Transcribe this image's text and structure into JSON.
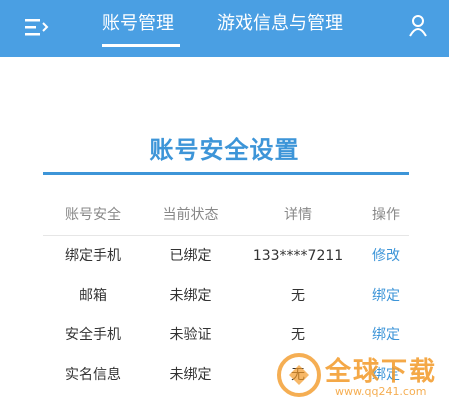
{
  "header": {
    "tabs": [
      {
        "label": "账号管理",
        "active": true
      },
      {
        "label": "游戏信息与管理",
        "active": false
      }
    ],
    "icons": {
      "menu": "menu-icon",
      "user": "user-icon"
    },
    "background_color": "#4a9fe3"
  },
  "main": {
    "title": "账号安全设置",
    "accent_color": "#3d95d8",
    "table": {
      "headers": [
        "账号安全",
        "当前状态",
        "详情",
        "操作"
      ],
      "rows": [
        {
          "item": "绑定手机",
          "status": "已绑定",
          "detail": "133****7211",
          "action": "修改"
        },
        {
          "item": "邮箱",
          "status": "未绑定",
          "detail": "无",
          "action": "绑定"
        },
        {
          "item": "安全手机",
          "status": "未验证",
          "detail": "无",
          "action": "绑定"
        },
        {
          "item": "实名信息",
          "status": "未绑定",
          "detail": "无",
          "action": "绑定"
        }
      ]
    }
  },
  "watermark": {
    "text": "全球下载",
    "url": "www.qq241.com"
  }
}
